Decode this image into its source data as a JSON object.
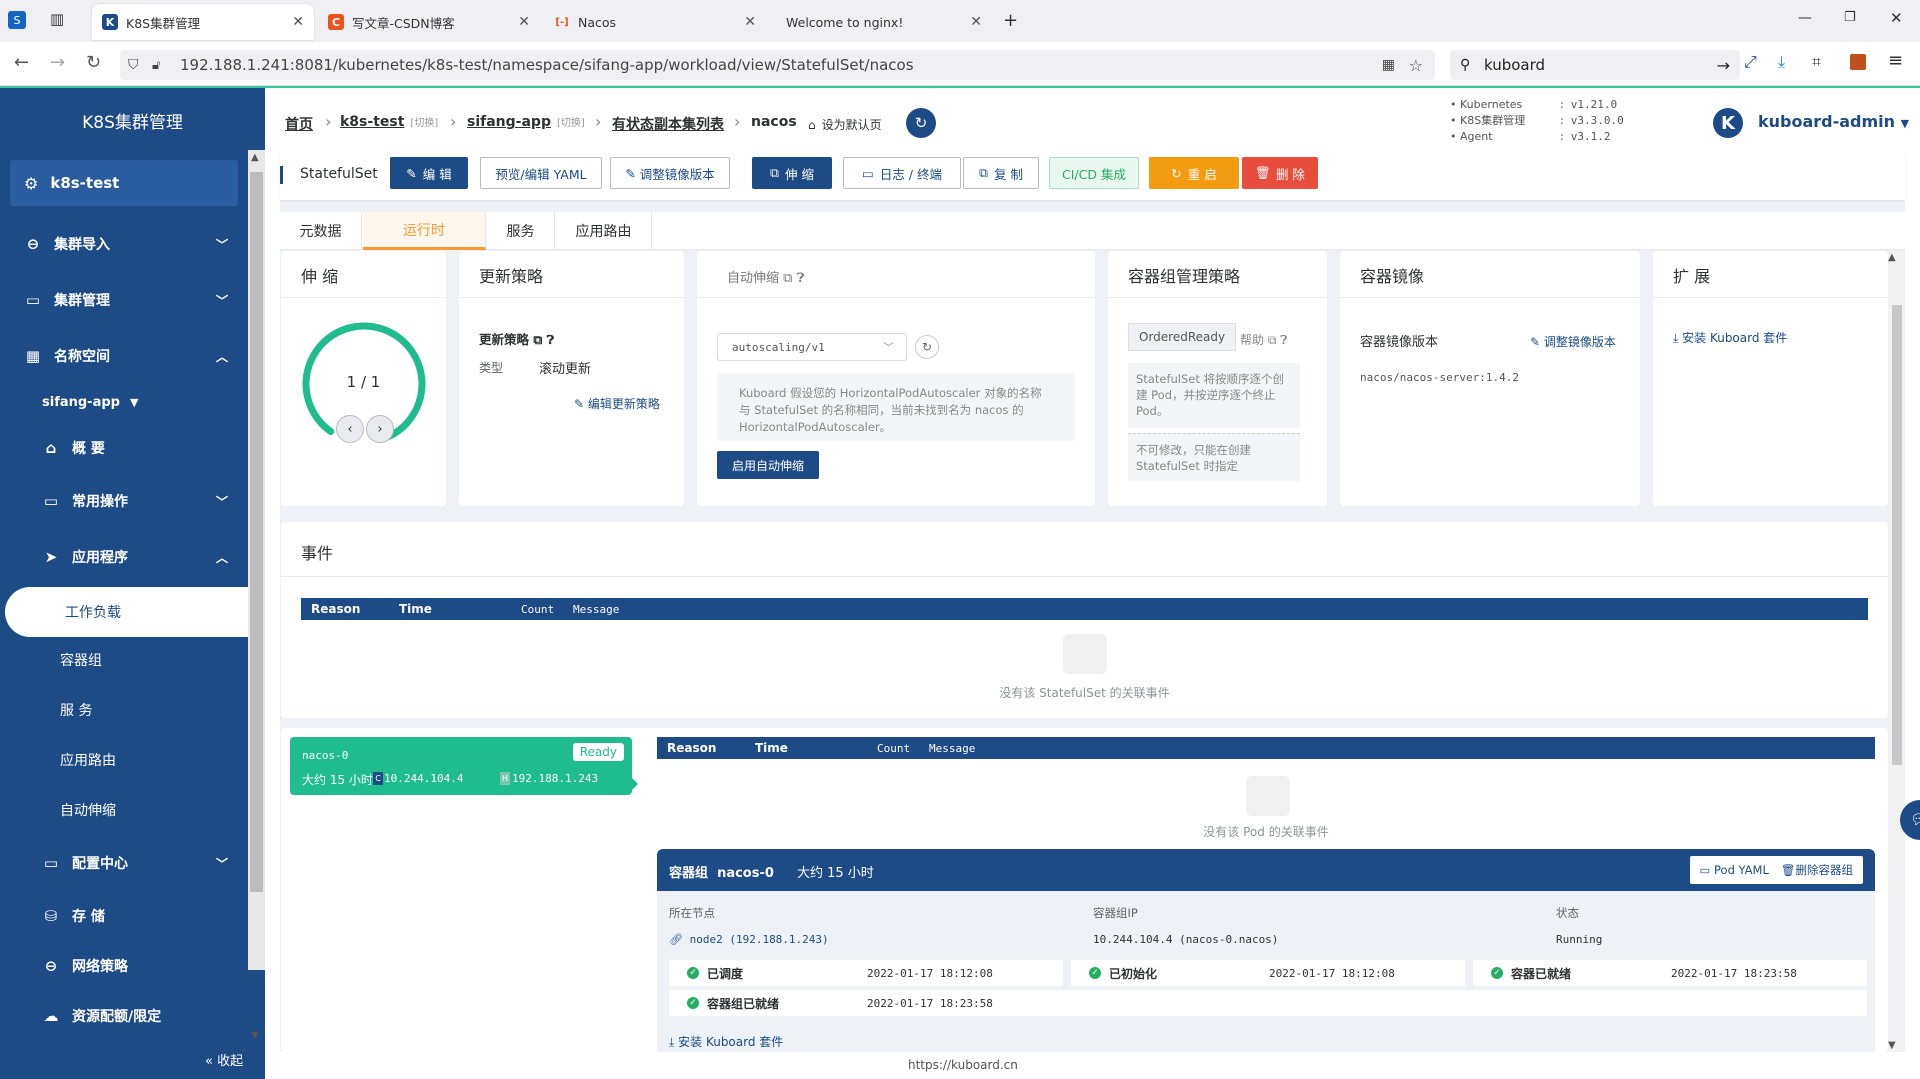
{
  "browser": {
    "tabs": [
      {
        "title": "K8S集群管理",
        "icon": "K"
      },
      {
        "title": "写文章-CSDN博客",
        "icon": "C"
      },
      {
        "title": "Nacos",
        "icon": "[-]"
      },
      {
        "title": "Welcome to nginx!",
        "icon": ""
      }
    ],
    "url": "192.188.1.241:8081/kubernetes/k8s-test/namespace/sifang-app/workload/view/StatefulSet/nacos",
    "search_value": "kuboard",
    "footer_url": "https://kuboard.cn"
  },
  "sidebar": {
    "title": "K8S集群管理",
    "cluster": "k8s-test",
    "items": [
      {
        "label": "集群导入"
      },
      {
        "label": "集群管理"
      },
      {
        "label": "名称空间"
      },
      {
        "label": "sifang-app"
      },
      {
        "label": "概 要"
      },
      {
        "label": "常用操作"
      },
      {
        "label": "应用程序"
      },
      {
        "label": "工作负载"
      },
      {
        "label": "容器组"
      },
      {
        "label": "服 务"
      },
      {
        "label": "应用路由"
      },
      {
        "label": "自动伸缩"
      },
      {
        "label": "配置中心"
      },
      {
        "label": "存 储"
      },
      {
        "label": "网络策略"
      },
      {
        "label": "资源配额/限定"
      }
    ],
    "collapse": "« 收起"
  },
  "header": {
    "breadcrumbs": [
      {
        "label": "首页"
      },
      {
        "label": "k8s-test",
        "tag": "[切换]"
      },
      {
        "label": "sifang-app",
        "tag": "[切换]"
      },
      {
        "label": "有状态副本集列表"
      },
      {
        "label": "nacos"
      }
    ],
    "set_default": "设为默认页",
    "versions": [
      {
        "name": "Kubernetes",
        "value": "v1.21.0"
      },
      {
        "name": "K8S集群管理",
        "value": "v3.3.0.0"
      },
      {
        "name": "Agent",
        "value": "v3.1.2"
      }
    ],
    "user": "kuboard-admin",
    "avatar": "K"
  },
  "toolbar": {
    "kind": "StatefulSet",
    "buttons": [
      "编 辑",
      "预览/编辑 YAML",
      "调整镜像版本",
      "伸 缩",
      "日志 / 终端",
      "复 制",
      "CI/CD 集成",
      "重 启",
      "删 除"
    ]
  },
  "tabs": [
    "元数据",
    "运行时",
    "服务",
    "应用路由"
  ],
  "scale": {
    "title": "伸 缩",
    "value": "1 / 1",
    "ready_fraction": 1.0
  },
  "update_strategy": {
    "title": "更新策略",
    "label": "更新策略",
    "type_label": "类型",
    "type_value": "滚动更新",
    "edit": "编辑更新策略"
  },
  "hpa": {
    "title": "自动伸缩",
    "select": "autoscaling/v1",
    "note": "Kuboard 假设您的 HorizontalPodAutoscaler 对象的名称与 StatefulSet 的名称相同，当前未找到名为 nacos 的 HorizontalPodAutoscaler。",
    "button": "启用自动伸缩"
  },
  "pod_policy": {
    "title": "容器组管理策略",
    "value": "OrderedReady",
    "help": "帮助",
    "note1": "StatefulSet 将按顺序逐个创建 Pod，并按逆序逐个终止 Pod。",
    "note2": "不可修改，只能在创建 StatefulSet 时指定"
  },
  "image": {
    "title": "容器镜像",
    "label": "容器镜像版本",
    "adjust": "调整镜像版本",
    "value": "nacos/nacos-server:1.4.2"
  },
  "extend": {
    "title": "扩 展",
    "install": "安装 Kuboard 套件"
  },
  "events": {
    "title": "事件",
    "columns": [
      "Reason",
      "Time",
      "Count",
      "Message"
    ],
    "empty": "没有该 StatefulSet 的关联事件"
  },
  "pod": {
    "name": "nacos-0",
    "status": "Ready",
    "age": "大约 15 小时",
    "container_ip": "10.244.104.4",
    "host_ip": "192.188.1.243",
    "events_columns": [
      "Reason",
      "Time",
      "Count",
      "Message"
    ],
    "events_empty": "没有该 Pod 的关联事件",
    "detail_title": "容器组",
    "yaml_btn": "Pod YAML",
    "delete_btn": "删除容器组",
    "node_label": "所在节点",
    "node_value": "node2  (192.188.1.243)",
    "ip_label": "容器组IP",
    "ip_value": "10.244.104.4  (nacos-0.nacos)",
    "state_label": "状态",
    "state_value": "Running",
    "conditions": [
      {
        "label": "已调度",
        "time": "2022-01-17 18:12:08"
      },
      {
        "label": "已初始化",
        "time": "2022-01-17 18:12:08"
      },
      {
        "label": "容器已就绪",
        "time": "2022-01-17 18:23:58"
      },
      {
        "label": "容器组已就绪",
        "time": "2022-01-17 18:23:58"
      }
    ],
    "install": "安装 Kuboard 套件"
  }
}
